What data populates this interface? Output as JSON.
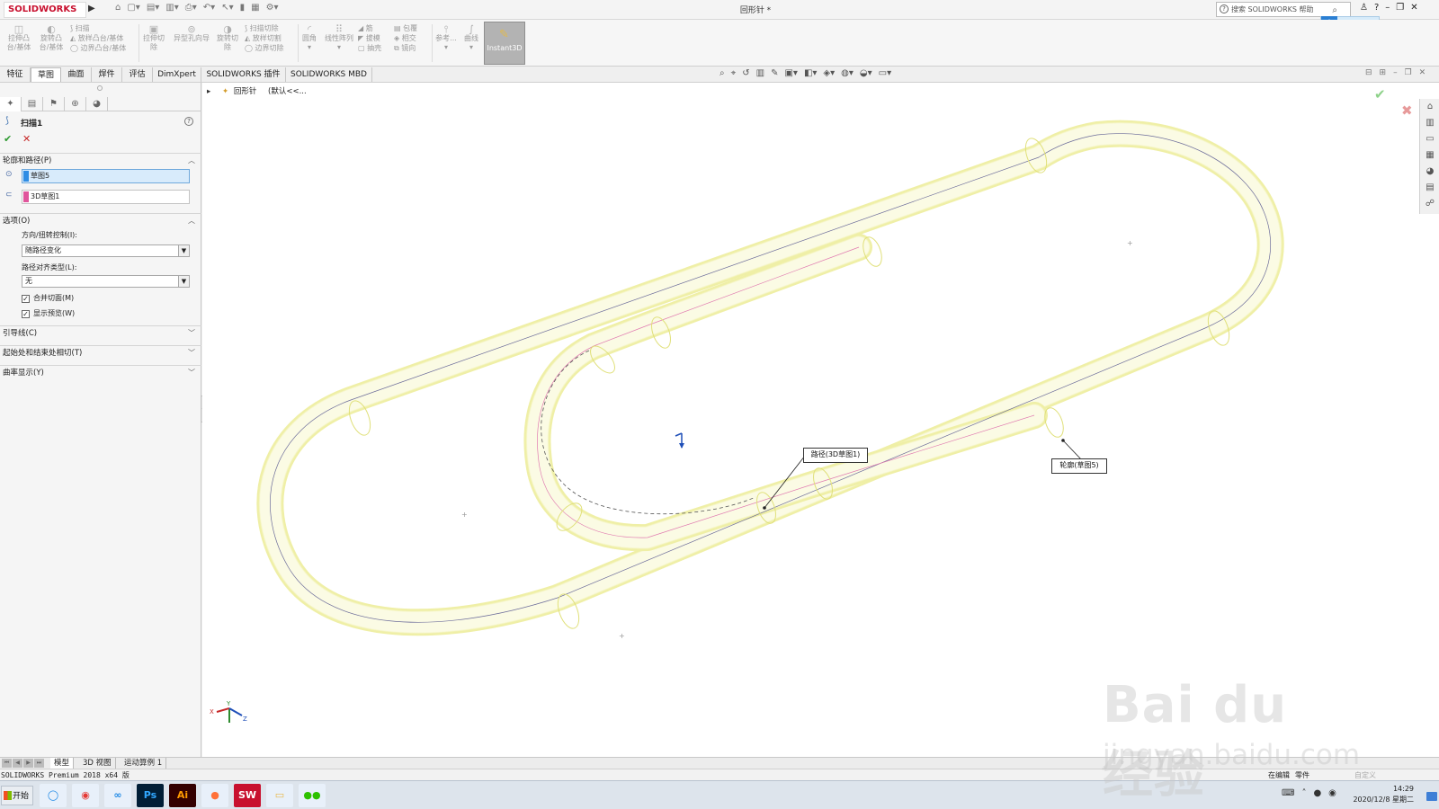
{
  "app": {
    "logo_text": "SOLIDWORKS",
    "doc_title": "回形针 *",
    "search_placeholder": "搜索 SOLIDWORKS 帮助"
  },
  "ribbon": {
    "buttons": [
      {
        "label": "拉伸凸\n台/基体",
        "icon": "extrude-boss-icon"
      },
      {
        "label": "旋转凸\n台/基体",
        "icon": "revolve-boss-icon"
      },
      {
        "label": "扫描",
        "icon": "sweep-icon"
      },
      {
        "label": "放样凸台/基体",
        "icon": "loft-icon"
      },
      {
        "label": "边界凸台/基体",
        "icon": "boundary-boss-icon"
      },
      {
        "label": "拉伸切\n除",
        "icon": "extrude-cut-icon"
      },
      {
        "label": "异型孔向导",
        "icon": "hole-wizard-icon"
      },
      {
        "label": "旋转切\n除",
        "icon": "revolve-cut-icon"
      },
      {
        "label": "扫描切除",
        "icon": "swept-cut-icon"
      },
      {
        "label": "放样切割",
        "icon": "lofted-cut-icon"
      },
      {
        "label": "边界切除",
        "icon": "boundary-cut-icon"
      },
      {
        "label": "圆角",
        "icon": "fillet-icon"
      },
      {
        "label": "线性阵列",
        "icon": "linear-pattern-icon"
      },
      {
        "label": "筋",
        "icon": "rib-icon"
      },
      {
        "label": "拔模",
        "icon": "draft-icon"
      },
      {
        "label": "抽壳",
        "icon": "shell-icon"
      },
      {
        "label": "包覆",
        "icon": "wrap-icon"
      },
      {
        "label": "相交",
        "icon": "intersect-icon"
      },
      {
        "label": "镜向",
        "icon": "mirror-icon"
      },
      {
        "label": "参考...",
        "icon": "reference-geometry-icon"
      },
      {
        "label": "曲线",
        "icon": "curves-icon"
      }
    ],
    "instant3d_label": "Instant3D"
  },
  "tabs": [
    "特征",
    "草图",
    "曲面",
    "焊件",
    "评估",
    "DimXpert",
    "SOLIDWORKS 插件",
    "SOLIDWORKS MBD"
  ],
  "active_tab_index": 1,
  "property_manager": {
    "title": "扫描1",
    "profile_path": {
      "header": "轮廓和路径(P)",
      "profile_value": "草图5",
      "path_value": "3D草图1"
    },
    "options": {
      "header": "选项(O)",
      "orientation_label": "方向/扭转控制(I):",
      "orientation_value": "随路径变化",
      "path_alignment_label": "路径对齐类型(L):",
      "path_alignment_value": "无",
      "merge_tangent_label": "合并切面(M)",
      "merge_tangent_checked": true,
      "show_preview_label": "显示预览(W)",
      "show_preview_checked": true
    },
    "guide_curves_header": "引导线(C)",
    "start_end_tangency_header": "起始处和结束处相切(T)",
    "curvature_display_header": "曲率显示(Y)"
  },
  "viewport": {
    "tree_item": "回形针",
    "tree_config": "(默认<<...",
    "callout_path": "路径(3D草图1)",
    "callout_profile": "轮廓(草图5)",
    "triad_labels": {
      "x": "X",
      "y": "Y",
      "z": "Z"
    }
  },
  "bottom_tabs": [
    "模型",
    "3D 视图",
    "运动算例 1"
  ],
  "status": {
    "left": "SOLIDWORKS Premium 2018 x64 版",
    "editing": "在编辑",
    "doc_type": "零件",
    "custom": "自定义"
  },
  "taskbar": {
    "start_label": "开始",
    "apps": [
      {
        "name": "browser-app",
        "glyph": "◯",
        "color": "#1e88e5",
        "bg": "#e8f0fa"
      },
      {
        "name": "chrome-app",
        "glyph": "◉",
        "color": "#e53935",
        "bg": "#e8f0fa"
      },
      {
        "name": "baidu-netdisk-app",
        "glyph": "∞",
        "color": "#1e88e5",
        "bg": "#e8f0fa"
      },
      {
        "name": "photoshop-app",
        "glyph": "Ps",
        "color": "#31a8ff",
        "bg": "#001e36"
      },
      {
        "name": "illustrator-app",
        "glyph": "Ai",
        "color": "#ff9a00",
        "bg": "#330000"
      },
      {
        "name": "firefox-app",
        "glyph": "●",
        "color": "#ff7139",
        "bg": "#e8f0fa"
      },
      {
        "name": "solidworks-app",
        "glyph": "SW",
        "color": "#ffffff",
        "bg": "#c8102e"
      },
      {
        "name": "file-explorer-app",
        "glyph": "▭",
        "color": "#e8b84a",
        "bg": "#e8f0fa"
      },
      {
        "name": "wechat-app",
        "glyph": "●●",
        "color": "#2dc100",
        "bg": "#e8f0fa"
      }
    ],
    "time": "14:29",
    "date": "2020/12/8 星期二"
  },
  "watermark": {
    "main": "Bai du 经验",
    "sub": "jingyan.baidu.com"
  },
  "colors": {
    "model_fill": "#f8f8d6",
    "model_edge": "#eeee9a",
    "accent_red": "#c8102e",
    "ok_green": "#2e9a31",
    "profile_swatch": "#2f8de4",
    "path_swatch": "#e0559b"
  }
}
